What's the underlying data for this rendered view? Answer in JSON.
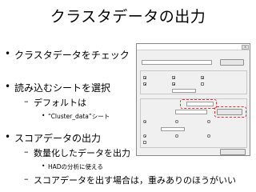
{
  "slide": {
    "title": "クラスタデータの出力",
    "bullets": [
      {
        "marker": "•",
        "text": "クラスタデータをチェック"
      },
      {
        "marker": "•",
        "text": "読み込むシートを選択"
      },
      {
        "marker": "–",
        "text": "デフォルトは"
      },
      {
        "marker": "•",
        "text": "“Cluster_data”シート"
      },
      {
        "marker": "•",
        "text": "スコアデータの出力"
      },
      {
        "marker": "–",
        "text": "数量化したデータを出力"
      },
      {
        "marker": "•",
        "text": "HADの分析に使える"
      },
      {
        "marker": "–",
        "text": "スコアデータを出す場合は，重みありのほうがいい"
      }
    ]
  }
}
